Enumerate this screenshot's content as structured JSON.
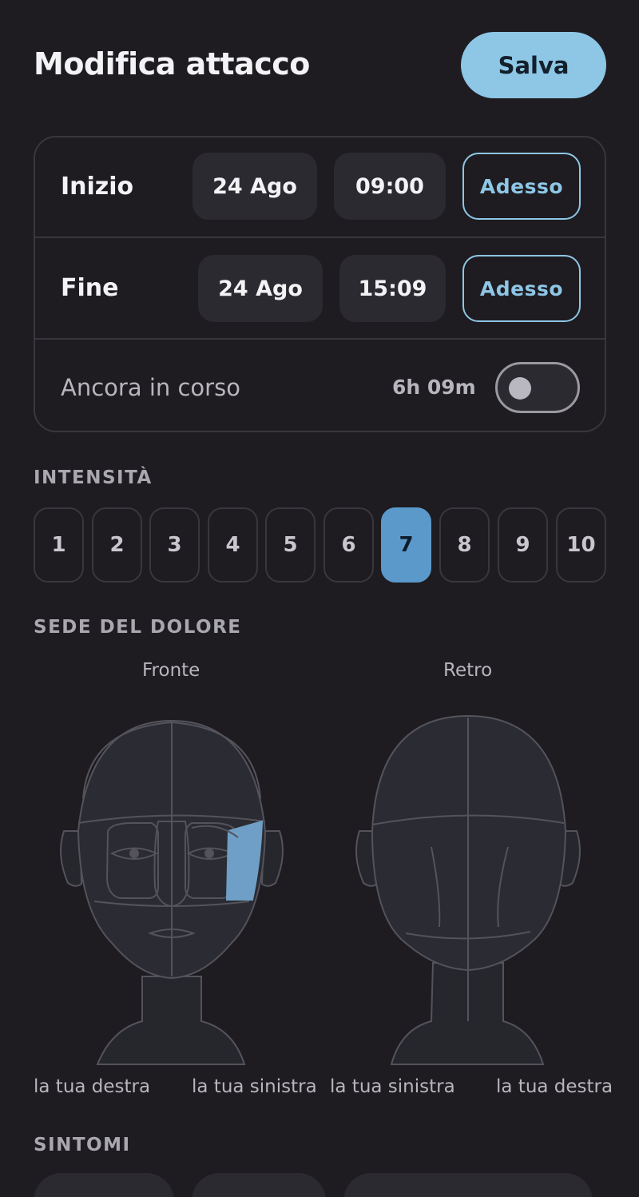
{
  "header": {
    "title": "Modifica attacco",
    "save_label": "Salva"
  },
  "time": {
    "start": {
      "label": "Inizio",
      "date": "24 Ago",
      "time": "09:00",
      "now_label": "Adesso"
    },
    "end": {
      "label": "Fine",
      "date": "24 Ago",
      "time": "15:09",
      "now_label": "Adesso"
    },
    "ongoing": {
      "label": "Ancora in corso",
      "duration": "6h 09m",
      "enabled": false
    }
  },
  "intensity": {
    "title": "INTENSITÀ",
    "levels": [
      "1",
      "2",
      "3",
      "4",
      "5",
      "6",
      "7",
      "8",
      "9",
      "10"
    ],
    "selected": "7"
  },
  "pain_location": {
    "title": "SEDE DEL DOLORE",
    "front": {
      "label": "Fronte",
      "left_side": "la tua destra",
      "right_side": "la tua sinistra"
    },
    "back": {
      "label": "Retro",
      "left_side": "la tua sinistra",
      "right_side": "la tua destra"
    }
  },
  "symptoms": {
    "title": "SINTOMI"
  },
  "colors": {
    "accent": "#8ec6e6",
    "selected": "#5b99cb",
    "background": "#1e1c20",
    "highlight_region": "#6f9fc6"
  }
}
